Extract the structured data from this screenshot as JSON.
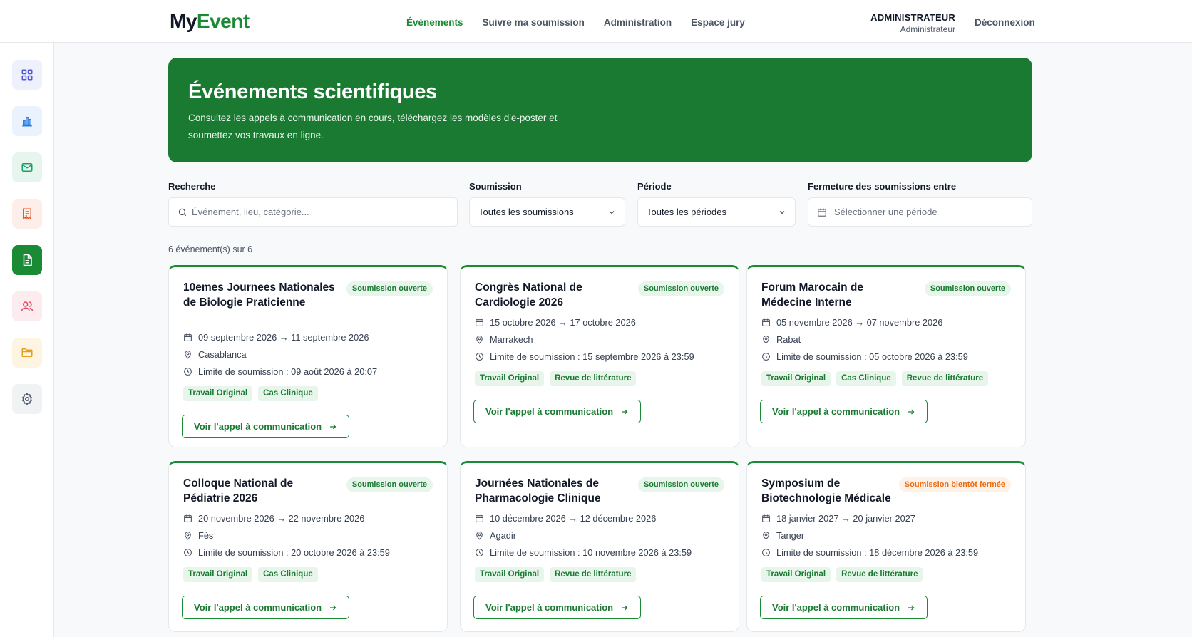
{
  "header": {
    "logo_my": "My",
    "logo_event": "Event",
    "nav": [
      {
        "label": "Événements",
        "active": true
      },
      {
        "label": "Suivre ma soumission",
        "active": false
      },
      {
        "label": "Administration",
        "active": false
      },
      {
        "label": "Espace jury",
        "active": false
      }
    ],
    "user_name": "ADMINISTRATEUR",
    "user_role": "Administrateur",
    "logout": "Déconnexion"
  },
  "sidebar": {
    "items": [
      {
        "icon": "dashboard-grid-icon",
        "bg": "#eef0fb",
        "color": "#4f5bd5"
      },
      {
        "icon": "bar-chart-icon",
        "bg": "#eaf3fd",
        "color": "#2b7de0"
      },
      {
        "icon": "mail-icon",
        "bg": "#e6f6ef",
        "color": "#16a06a"
      },
      {
        "icon": "receipt-icon",
        "bg": "#fdeeea",
        "color": "#e55a2b"
      },
      {
        "icon": "document-icon",
        "bg": "#1a8a35",
        "color": "#ffffff"
      },
      {
        "icon": "users-icon",
        "bg": "#fdecef",
        "color": "#e0455f"
      },
      {
        "icon": "folder-icon",
        "bg": "#fdf4e2",
        "color": "#e5a019"
      },
      {
        "icon": "gear-icon",
        "bg": "#f1f2f4",
        "color": "#4b5563"
      }
    ]
  },
  "hero": {
    "title": "Événements scientifiques",
    "subtitle": "Consultez les appels à communication en cours, téléchargez les modèles d'e-poster et soumettez vos travaux en ligne."
  },
  "filters": {
    "search_label": "Recherche",
    "search_placeholder": "Événement, lieu, catégorie...",
    "submission_label": "Soumission",
    "submission_value": "Toutes les soumissions",
    "period_label": "Période",
    "period_value": "Toutes les périodes",
    "closing_label": "Fermeture des soumissions entre",
    "closing_placeholder": "Sélectionner une période"
  },
  "results_count": "6 événement(s) sur 6",
  "events": [
    {
      "title": "10emes Journees Nationales de Biologie Praticienne",
      "status": "Soumission ouverte",
      "status_kind": "open",
      "dates": "09 septembre 2026 → 11 septembre 2026",
      "location": "Casablanca",
      "deadline": "Limite de soumission : 09 août 2026 à 20:07",
      "tags": [
        "Travail Original",
        "Cas Clinique"
      ],
      "cta": "Voir l'appel à communication"
    },
    {
      "title": "Congrès National de Cardiologie 2026",
      "status": "Soumission ouverte",
      "status_kind": "open",
      "dates": "15 octobre 2026 → 17 octobre 2026",
      "location": "Marrakech",
      "deadline": "Limite de soumission : 15 septembre 2026 à 23:59",
      "tags": [
        "Travail Original",
        "Revue de littérature"
      ],
      "cta": "Voir l'appel à communication"
    },
    {
      "title": "Forum Marocain de Médecine Interne",
      "status": "Soumission ouverte",
      "status_kind": "open",
      "dates": "05 novembre 2026 → 07 novembre 2026",
      "location": "Rabat",
      "deadline": "Limite de soumission : 05 octobre 2026 à 23:59",
      "tags": [
        "Travail Original",
        "Cas Clinique",
        "Revue de littérature"
      ],
      "cta": "Voir l'appel à communication"
    },
    {
      "title": "Colloque National de Pédiatrie 2026",
      "status": "Soumission ouverte",
      "status_kind": "open",
      "dates": "20 novembre 2026 → 22 novembre 2026",
      "location": "Fès",
      "deadline": "Limite de soumission : 20 octobre 2026 à 23:59",
      "tags": [
        "Travail Original",
        "Cas Clinique"
      ],
      "cta": "Voir l'appel à communication"
    },
    {
      "title": "Journées Nationales de Pharmacologie Clinique",
      "status": "Soumission ouverte",
      "status_kind": "open",
      "dates": "10 décembre 2026 → 12 décembre 2026",
      "location": "Agadir",
      "deadline": "Limite de soumission : 10 novembre 2026 à 23:59",
      "tags": [
        "Travail Original",
        "Revue de littérature"
      ],
      "cta": "Voir l'appel à communication"
    },
    {
      "title": "Symposium de Biotechnologie Médicale",
      "status": "Soumission bientôt fermée",
      "status_kind": "soon",
      "dates": "18 janvier 2027 → 20 janvier 2027",
      "location": "Tanger",
      "deadline": "Limite de soumission : 18 décembre 2026 à 23:59",
      "tags": [
        "Travail Original",
        "Revue de littérature"
      ],
      "cta": "Voir l'appel à communication"
    }
  ]
}
